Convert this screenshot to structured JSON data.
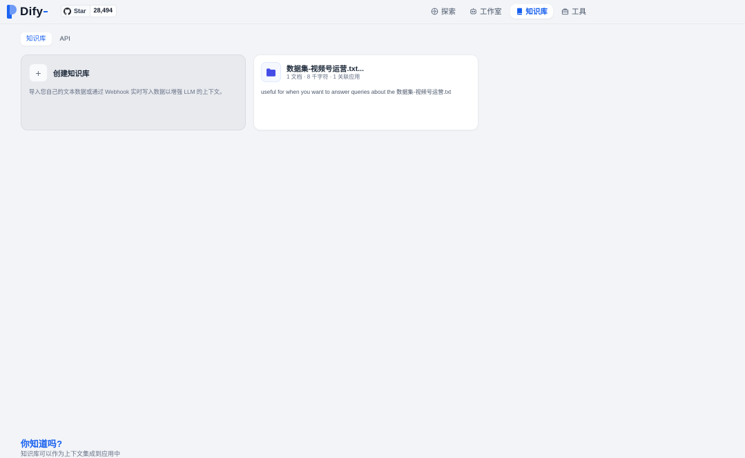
{
  "brand": {
    "name": "Dify",
    "accent": "#1c64f2"
  },
  "github": {
    "label": "Star",
    "count": "28,494",
    "icon": "github-icon"
  },
  "nav": [
    {
      "label": "探索",
      "icon": "compass-icon",
      "active": false
    },
    {
      "label": "工作室",
      "icon": "robot-icon",
      "active": false
    },
    {
      "label": "知识库",
      "icon": "book-icon",
      "active": true
    },
    {
      "label": "工具",
      "icon": "toolbox-icon",
      "active": false
    }
  ],
  "tabs": [
    {
      "label": "知识库",
      "active": true
    },
    {
      "label": "API",
      "active": false
    }
  ],
  "create_card": {
    "icon": "plus-icon",
    "title": "创建知识库",
    "description": "导入您自己的文本数据或通过 Webhook 实时写入数据以增强 LLM 的上下文。"
  },
  "datasets": [
    {
      "icon": "folder-icon",
      "title": "数据集-视频号运营.txt...",
      "meta": "1 文档 · 8 千字符 · 1 关联应用",
      "description": "useful for when you want to answer queries about the 数据集-视频号运营.txt"
    }
  ],
  "did_you_know": {
    "title": "你知道吗?",
    "subtitle": "知识库可以作为上下文集成到应用中"
  }
}
